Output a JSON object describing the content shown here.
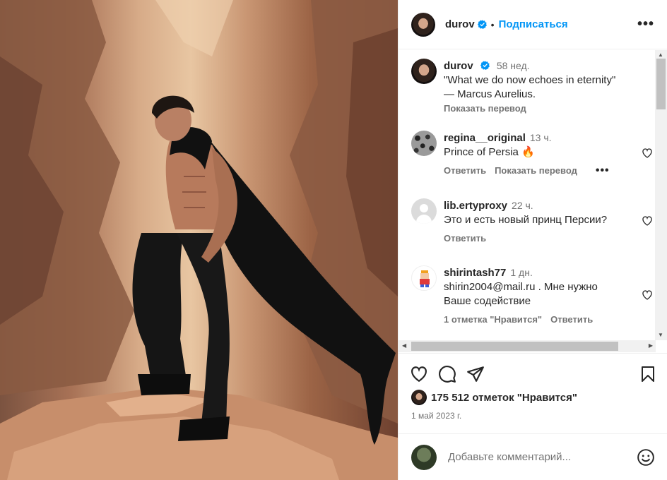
{
  "post": {
    "username": "durov",
    "follow_label": "Подписаться",
    "dot": "•",
    "more_label": "•••"
  },
  "caption": {
    "username": "durov",
    "time": "58 нед.",
    "text_line1": "\"What we do now echoes in eternity\"",
    "text_line2": "— Marcus Aurelius.",
    "translate_label": "Показать перевод"
  },
  "comments": [
    {
      "username": "regina__original",
      "time": "13 ч.",
      "text": "Prince of Persia 🔥",
      "reply_label": "Ответить",
      "translate_label": "Показать перевод",
      "more_label": "•••"
    },
    {
      "username": "lib.ertyproxy",
      "time": "22 ч.",
      "text": "Это и есть новый принц Персии?",
      "reply_label": "Ответить"
    },
    {
      "username": "shirintash77",
      "time": "1 дн.",
      "text_line1": "shirin2004@mail.ru . Мне нужно",
      "text_line2": "Ваше содействие",
      "likes_label": "1 отметка \"Нравится\"",
      "reply_label": "Ответить"
    }
  ],
  "likes_text": "175 512 отметок \"Нравится\"",
  "date": "1 май 2023 г.",
  "add_comment_placeholder": "Добавьте комментарий...",
  "colors": {
    "accent": "#0095f6",
    "verified": "#0095f6",
    "secondary_text": "#737373"
  },
  "icons": [
    "verified-icon",
    "more-icon",
    "heart-icon",
    "comment-icon",
    "share-icon",
    "save-icon",
    "smile-icon"
  ]
}
